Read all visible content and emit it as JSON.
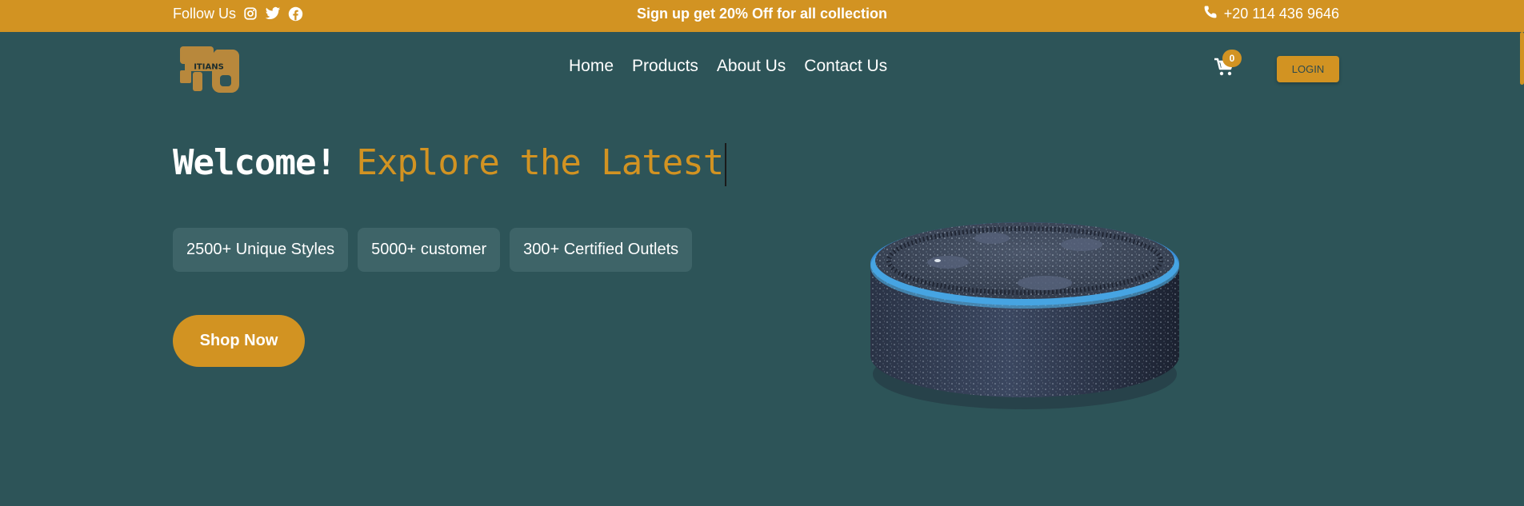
{
  "topbar": {
    "follow_label": "Follow Us",
    "social_icons": [
      "instagram-icon",
      "twitter-icon",
      "facebook-icon"
    ],
    "promo": "Sign up get 20% Off for all collection",
    "phone": "+20 114 436 9646"
  },
  "logo": {
    "text": "ITIANS"
  },
  "nav": {
    "items": [
      "Home",
      "Products",
      "About Us",
      "Contact Us"
    ]
  },
  "cart": {
    "count": "0"
  },
  "login_label": "LOGIN",
  "hero": {
    "headline_white": "Welcome!",
    "headline_accent": "Explore the Latest",
    "stats": [
      "2500+ Unique Styles",
      "5000+ customer",
      "300+ Certified Outlets"
    ],
    "cta": "Shop Now"
  },
  "colors": {
    "accent": "#d29322",
    "background": "#2d5458",
    "stat_bg": "#3e6468"
  }
}
